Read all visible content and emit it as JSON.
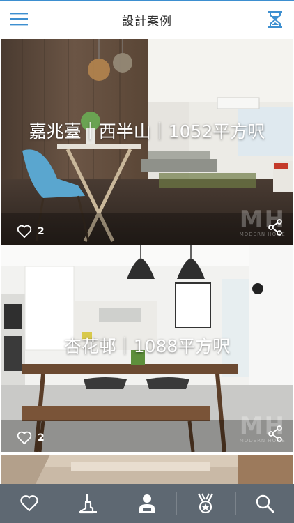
{
  "header": {
    "title": "設計案例",
    "menu_icon": "hamburger-menu-icon",
    "right_icon": "hourglass-icon",
    "accent_color": "#3d8fd0"
  },
  "cases": [
    {
      "caption": "嘉兆臺｜西半山｜1052平方呎",
      "likes": "2",
      "watermark": "MH",
      "watermark_sub": "MODERN HOME"
    },
    {
      "caption": "杏花邨｜1088平方呎",
      "likes": "2",
      "watermark": "MH",
      "watermark_sub": "MODERN HOME"
    }
  ],
  "tabbar": {
    "background": "#5e6872",
    "tabs": [
      {
        "icon": "heart-icon"
      },
      {
        "icon": "paint-roller-icon"
      },
      {
        "icon": "designer-person-icon"
      },
      {
        "icon": "medal-icon"
      },
      {
        "icon": "search-icon"
      }
    ]
  }
}
